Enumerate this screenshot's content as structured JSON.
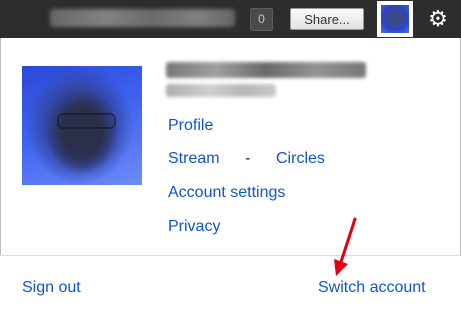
{
  "topbar": {
    "notification_count": "0",
    "share_label": "Share..."
  },
  "account_menu": {
    "links": {
      "profile": "Profile",
      "stream": "Stream",
      "separator": "-",
      "circles": "Circles",
      "account_settings": "Account settings",
      "privacy": "Privacy"
    },
    "footer": {
      "sign_out": "Sign out",
      "switch_account": "Switch account"
    }
  },
  "icons": {
    "settings": "gear-icon",
    "annotation": "red-arrow-annotation"
  },
  "colors": {
    "link": "#1155cc",
    "topbar": "#2d2d2d",
    "annotation_arrow": "#e3000f"
  }
}
